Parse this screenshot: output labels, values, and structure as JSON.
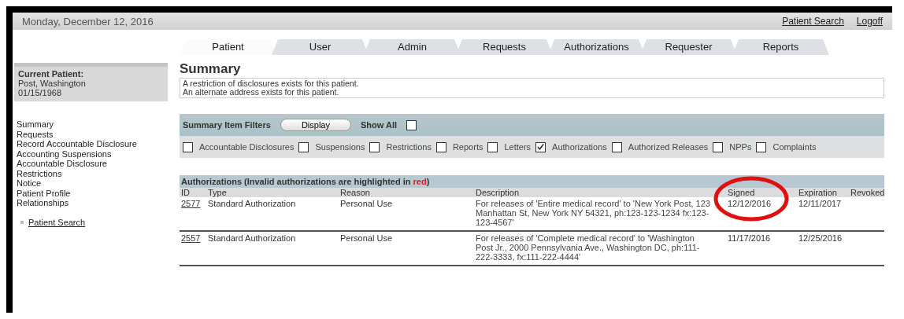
{
  "header": {
    "date": "Monday, December 12, 2016",
    "links": [
      "Patient Search",
      "Logoff"
    ]
  },
  "tabs": [
    {
      "label": "Patient",
      "selected": true
    },
    {
      "label": "User",
      "selected": false
    },
    {
      "label": "Admin",
      "selected": false
    },
    {
      "label": "Requests",
      "selected": false
    },
    {
      "label": "Authorizations",
      "selected": false
    },
    {
      "label": "Requester",
      "selected": false
    },
    {
      "label": "Reports",
      "selected": false
    }
  ],
  "current_patient": {
    "label": "Current Patient:",
    "name": "Post, Washington",
    "dob": "01/15/1968"
  },
  "sidebar": {
    "items": [
      "Summary",
      "Requests",
      "Record Accountable Disclosure",
      "Accounting Suspensions",
      "Accountable Disclosure",
      "Restrictions",
      "Notice",
      "Patient Profile",
      "Relationships"
    ],
    "link": "Patient Search"
  },
  "summary": {
    "title": "Summary",
    "notices": [
      "A restriction of disclosures exists for this patient.",
      "An alternate address exists for this patient."
    ]
  },
  "filters": {
    "title": "Summary Item Filters",
    "button": "Display",
    "show_all": {
      "label": "Show All",
      "checked": false
    },
    "items": [
      {
        "label": "Accountable Disclosures",
        "checked": false
      },
      {
        "label": "Suspensions",
        "checked": false
      },
      {
        "label": "Restrictions",
        "checked": false
      },
      {
        "label": "Reports",
        "checked": false
      },
      {
        "label": "Letters",
        "checked": false
      },
      {
        "label": "Authorizations",
        "checked": true
      },
      {
        "label": "Authorized Releases",
        "checked": false
      },
      {
        "label": "NPPs",
        "checked": false
      },
      {
        "label": "Complaints",
        "checked": false
      }
    ]
  },
  "authorizations": {
    "title": "Authorizations (Invalid authorizations are highlighted in ",
    "highlight": "red",
    "title_end": ")",
    "columns": [
      "ID",
      "Type",
      "Reason",
      "Description",
      "Signed",
      "Expiration",
      "Revoked"
    ],
    "rows": [
      {
        "id": "2577",
        "type": "Standard Authorization",
        "reason": "Personal Use",
        "description": "For releases of 'Entire medical record' to 'New York Post, 123 Manhattan St, New York NY 54321, ph:123-123-1234 fx:123-123-4567'",
        "signed": "12/12/2016",
        "expiration": "12/11/2017"
      },
      {
        "id": "2557",
        "type": "Standard Authorization",
        "reason": "Personal Use",
        "description": "For releases of 'Complete medical record' to 'Washington Post Jr., 2000 Pennsylvania Ave., Washington DC, ph:111-222-3333, fx:111-222-4444'",
        "signed": "11/17/2016",
        "expiration": "12/25/2016"
      }
    ]
  }
}
